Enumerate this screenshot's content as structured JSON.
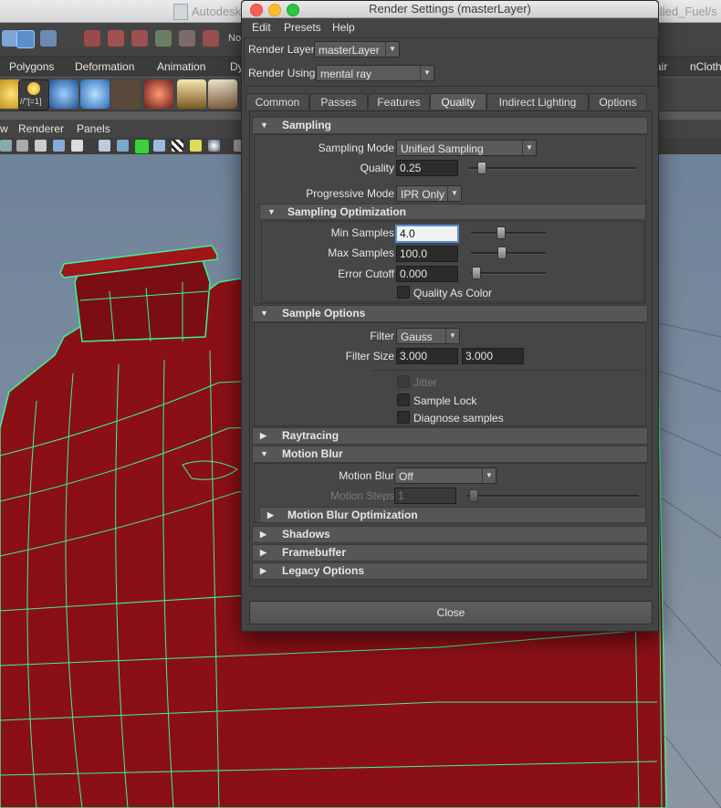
{
  "host": {
    "window_title": "Autodesk",
    "file_title_fragment": "illed_Fuel/s",
    "status_no_label": "No",
    "menu_sets": [
      "Polygons",
      "Deformation",
      "Animation",
      "Dy",
      "air",
      "nCloth"
    ],
    "shelf_chip_label": "//\"[=1]",
    "panel_menus": [
      "w",
      "Renderer",
      "Panels"
    ]
  },
  "render_settings": {
    "title": "Render Settings (masterLayer)",
    "menus": [
      "Edit",
      "Presets",
      "Help"
    ],
    "render_layer_label": "Render Layer",
    "render_layer_value": "masterLayer",
    "render_using_label": "Render Using",
    "render_using_value": "mental ray",
    "tabs": [
      "Common",
      "Passes",
      "Features",
      "Quality",
      "Indirect Lighting",
      "Options"
    ],
    "active_tab": "Quality",
    "sampling": {
      "title": "Sampling",
      "mode_label": "Sampling Mode",
      "mode_value": "Unified Sampling",
      "quality_label": "Quality",
      "quality_value": "0.25",
      "quality_slider_fraction": 0.05,
      "progressive_label": "Progressive Mode",
      "progressive_value": "IPR Only",
      "optimization": {
        "title": "Sampling Optimization",
        "min_label": "Min Samples",
        "min_value": "4.0",
        "max_label": "Max Samples",
        "max_value": "100.0",
        "error_label": "Error Cutoff",
        "error_value": "0.000",
        "quality_as_color_label": "Quality As Color"
      }
    },
    "sample_options": {
      "title": "Sample Options",
      "filter_label": "Filter",
      "filter_value": "Gauss",
      "filter_size_label": "Filter Size",
      "filter_size_x": "3.000",
      "filter_size_y": "3.000",
      "jitter_label": "Jitter",
      "sample_lock_label": "Sample Lock",
      "diagnose_label": "Diagnose samples"
    },
    "raytracing_title": "Raytracing",
    "motion_blur": {
      "title": "Motion Blur",
      "label": "Motion Blur",
      "value": "Off",
      "steps_label": "Motion Steps",
      "steps_value": "1",
      "optimization_title": "Motion Blur Optimization"
    },
    "shadows_title": "Shadows",
    "framebuffer_title": "Framebuffer",
    "legacy_title": "Legacy Options",
    "close_label": "Close"
  },
  "colors": {
    "traffic_close": "#fc5f57",
    "traffic_min": "#fdbc2e",
    "traffic_max": "#28c840",
    "mesh_red": "#8a1016",
    "wire_green": "#37f59a"
  }
}
